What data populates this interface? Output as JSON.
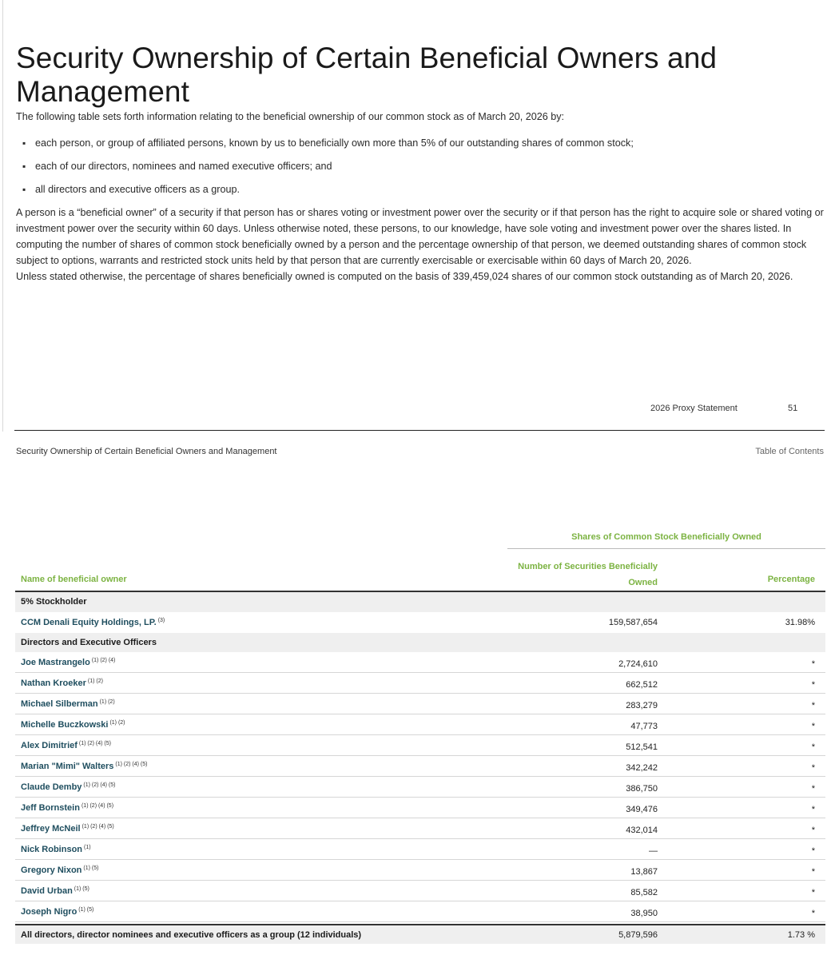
{
  "page": {
    "title": "Security Ownership of Certain Beneficial Owners and Management",
    "intro": "The following table sets forth information relating to the beneficial ownership of our common stock as of March 20, 2026 by:",
    "bullets": [
      "each person, or group of affiliated persons, known by us to beneficially own more than 5% of our outstanding shares of common stock;",
      "each of our directors, nominees and named executive officers; and",
      "all directors and executive officers as a group."
    ],
    "bullet_glyph": "▪",
    "para_beneficial": "A person is a “beneficial owner” of a security if that person has or shares voting or investment power over the security or if that person has the right to acquire sole or shared voting or investment power over the security within 60 days. Unless otherwise noted, these persons, to our knowledge, have sole voting and investment power over the shares listed. In computing the number of shares of common stock beneficially owned by a person and the percentage ownership of that person, we deemed outstanding shares of common stock subject to options, warrants and restricted stock units held by that person that are currently exercisable or exercisable within 60 days of March 20, 2026.",
    "para_basis": "Unless stated otherwise, the percentage of shares beneficially owned is computed on the basis of 339,459,024 shares of our common stock outstanding as of March 20, 2026."
  },
  "footer": {
    "label": "2026 Proxy Statement",
    "page_number": "51"
  },
  "running_header": {
    "title": "Security Ownership of Certain Beneficial Owners and Management",
    "toc_link": "Table of Contents"
  },
  "table": {
    "group_header": "Shares of Common Stock Beneficially Owned",
    "col_name": "Name of beneficial owner",
    "col_num_line1": "Number of Securities Beneficially",
    "col_num_line2": "Owned",
    "col_pct": "Percentage",
    "colors": {
      "header_green": "#7cb342",
      "name_teal": "#1f4e5f",
      "section_bg": "#efefef"
    },
    "section_holders": "5% Stockholder",
    "holder": {
      "name": "CCM Denali Equity Holdings, LP.",
      "notes": "(3)",
      "shares": "159,587,654",
      "pct": "31.98%"
    },
    "section_directors": "Directors and Executive Officers",
    "directors": [
      {
        "name": "Joe Mastrangelo",
        "notes": "(1) (2) (4)",
        "shares": "2,724,610",
        "pct": "*"
      },
      {
        "name": "Nathan Kroeker",
        "notes": "(1) (2)",
        "shares": "662,512",
        "pct": "*"
      },
      {
        "name": "Michael Silberman",
        "notes": "(1) (2)",
        "shares": "283,279",
        "pct": "*"
      },
      {
        "name": "Michelle Buczkowski",
        "notes": "(1) (2)",
        "shares": "47,773",
        "pct": "*"
      },
      {
        "name": "Alex Dimitrief",
        "notes": "(1) (2) (4) (5)",
        "shares": "512,541",
        "pct": "*"
      },
      {
        "name": "Marian \"Mimi\" Walters",
        "notes": "(1) (2) (4) (5)",
        "shares": "342,242",
        "pct": "*"
      },
      {
        "name": "Claude Demby",
        "notes": "(1) (2) (4) (5)",
        "shares": "386,750",
        "pct": "*"
      },
      {
        "name": "Jeff Bornstein",
        "notes": "(1) (2) (4) (5)",
        "shares": "349,476",
        "pct": "*"
      },
      {
        "name": "Jeffrey McNeil",
        "notes": "(1) (2) (4) (5)",
        "shares": "432,014",
        "pct": "*"
      },
      {
        "name": "Nick Robinson",
        "notes": "(1)",
        "shares": "—",
        "pct": "*"
      },
      {
        "name": "Gregory Nixon",
        "notes": "(1) (5)",
        "shares": "13,867",
        "pct": "*"
      },
      {
        "name": "David Urban",
        "notes": "(1) (5)",
        "shares": "85,582",
        "pct": "*"
      },
      {
        "name": "Joseph Nigro",
        "notes": "(1) (5)",
        "shares": "38,950",
        "pct": "*"
      }
    ],
    "total": {
      "name": "All directors, director nominees and executive officers as a group (12 individuals)",
      "shares": "5,879,596",
      "pct": "1.73 %"
    }
  }
}
